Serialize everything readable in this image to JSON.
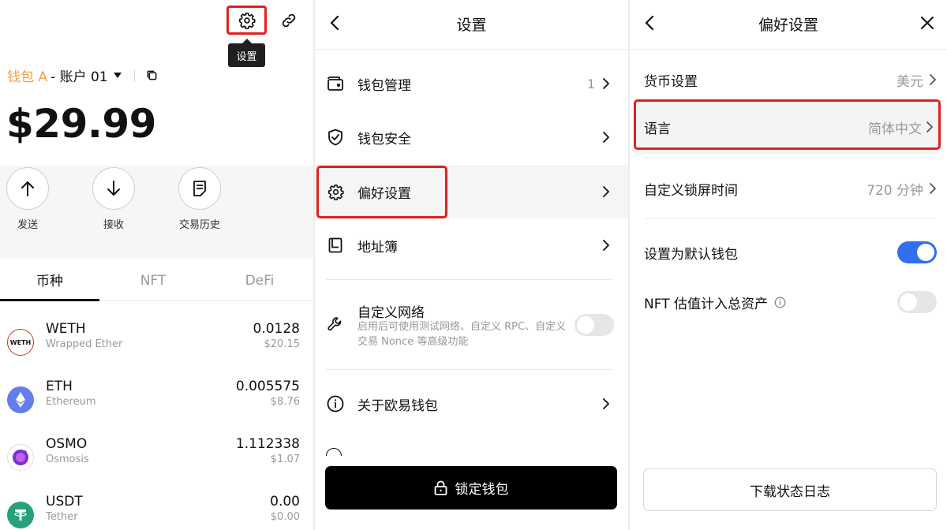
{
  "wallet": {
    "tooltip": "设置",
    "wallet_name": "钱包 A",
    "account_name": "- 账户 01",
    "balance": "$29.99",
    "actions": [
      {
        "label": "发送",
        "icon": "arrow-up-icon"
      },
      {
        "label": "接收",
        "icon": "arrow-down-icon"
      },
      {
        "label": "交易历史",
        "icon": "history-icon"
      }
    ],
    "tabs": [
      "币种",
      "NFT",
      "DeFi"
    ],
    "active_tab": "币种",
    "tokens": [
      {
        "symbol": "WETH",
        "name": "Wrapped Ether",
        "amount": "0.0128",
        "usd": "$20.15",
        "icon_text": "WETH"
      },
      {
        "symbol": "ETH",
        "name": "Ethereum",
        "amount": "0.005575",
        "usd": "$8.76"
      },
      {
        "symbol": "OSMO",
        "name": "Osmosis",
        "amount": "1.112338",
        "usd": "$1.07"
      },
      {
        "symbol": "USDT",
        "name": "Tether",
        "amount": "0.00",
        "usd": "$0.00"
      }
    ]
  },
  "settings": {
    "title": "设置",
    "rows": [
      {
        "label": "钱包管理",
        "count": "1",
        "icon": "wallet-icon"
      },
      {
        "label": "钱包安全",
        "icon": "shield-check-icon"
      },
      {
        "label": "偏好设置",
        "icon": "gear-icon"
      },
      {
        "label": "地址簿",
        "icon": "address-book-icon"
      }
    ],
    "custom_network": {
      "label": "自定义网络",
      "description": "启用后可使用测试网络、自定义 RPC、自定义交易 Nonce 等高级功能",
      "enabled": false
    },
    "about": "关于欧易钱包",
    "lock_button": "锁定钱包"
  },
  "preferences": {
    "title": "偏好设置",
    "rows": [
      {
        "label": "货币设置",
        "value": "美元"
      },
      {
        "label": "语言",
        "value": "简体中文"
      },
      {
        "label": "自定义锁屏时间",
        "value": "720 分钟"
      }
    ],
    "default_wallet": {
      "label": "设置为默认钱包",
      "enabled": true
    },
    "nft_valuation": {
      "label": "NFT 估值计入总资产",
      "enabled": false
    },
    "download_button": "下载状态日志"
  },
  "colors": {
    "accent_orange": "#f0a14a",
    "highlight_red": "#e02020",
    "toggle_on": "#2f6ff0",
    "eth_purple": "#627eea",
    "usdt_green": "#26a17b"
  }
}
